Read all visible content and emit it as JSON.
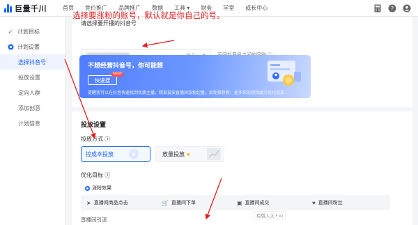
{
  "topbar": {
    "logo_text": "巨量千川",
    "nav": [
      "首页",
      "竞价推广",
      "品牌推广",
      "数据",
      "工具",
      "财务",
      "学堂",
      "成长中心"
    ],
    "icons": [
      "calculator-icon",
      "help-icon",
      "user-icon"
    ]
  },
  "sidebar": {
    "items": [
      {
        "label": "计划目标",
        "state": "done"
      },
      {
        "label": "计划设置",
        "state": "current"
      }
    ],
    "sub_items": [
      {
        "label": "选择抖音号",
        "active": true
      },
      {
        "label": "投放设置",
        "active": false
      },
      {
        "label": "定向人群",
        "active": false
      },
      {
        "label": "添加创意",
        "active": false
      },
      {
        "label": "计划信息",
        "active": false
      }
    ]
  },
  "account": {
    "title": "请选择要开播的抖音号",
    "tag": "官方",
    "hint": "不同抖音号之间的区别"
  },
  "annotation": "选择要涨粉的账号，默认就是你自己的号。",
  "banner": {
    "title": "不想经营抖音号，你可能想",
    "button": "快速搜",
    "badge": "NEW",
    "desc": "提醒我可以在抖音快速找到优质主播，精准投放直播间涨粉起量。后期推荐新：更多你的视频展示优化投放……"
  },
  "settings": {
    "section_title": "投放设置",
    "mode_label": "投放方式",
    "mode_options": [
      "控成本投放",
      "放量投放"
    ],
    "goal_label": "优化目标",
    "radio_label": "涨粉效果",
    "goals": [
      "直播间商品点击",
      "直播间下单",
      "直播间成交",
      "直播间粉丝"
    ],
    "more_label": "直播间引流"
  },
  "watermark": "有赞人大 • AI",
  "colors": {
    "accent": "#1a64ff",
    "annotation": "#e02020"
  }
}
